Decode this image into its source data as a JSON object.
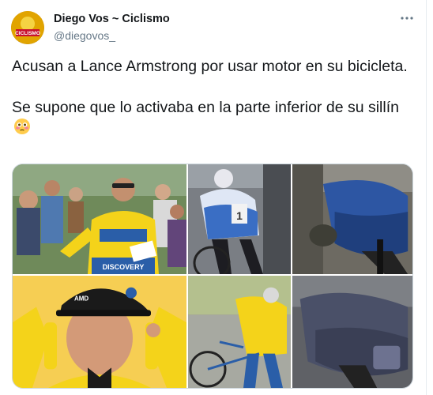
{
  "author": {
    "name": "Diego Vos ~ Ciclismo",
    "handle": "@diegovos_",
    "avatar_text": "CICLISMO"
  },
  "tweet": {
    "line1": "Acusan a Lance Armstrong por usar motor en su bicicleta.",
    "line2": "Se supone que lo activaba en la parte inferior de su sillín",
    "emoji": "flushed-face-emoji"
  },
  "media": {
    "photo_count": 6,
    "jersey_text": "DISCOVERY",
    "cap_text": "AMD"
  },
  "colors": {
    "text": "#14171a",
    "secondary": "#657786",
    "border": "#ccd6dd",
    "jersey_yellow": "#f4d31a",
    "team_blue": "#2a5ea8"
  }
}
